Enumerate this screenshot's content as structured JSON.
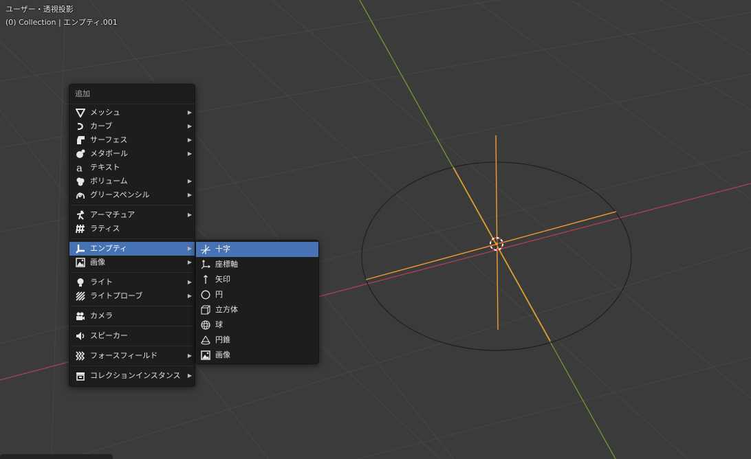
{
  "viewport": {
    "view_name": "ユーザー・透視投影",
    "object_info": "(0) Collection | エンプティ.001"
  },
  "add_menu": {
    "title": "追加",
    "items": [
      {
        "label": "メッシュ",
        "icon": "mesh-icon",
        "submenu": true
      },
      {
        "label": "カーブ",
        "icon": "curve-icon",
        "submenu": true
      },
      {
        "label": "サーフェス",
        "icon": "surface-icon",
        "submenu": true
      },
      {
        "label": "メタボール",
        "icon": "metaball-icon",
        "submenu": true
      },
      {
        "label": "テキスト",
        "icon": "text-icon",
        "submenu": false
      },
      {
        "label": "ボリューム",
        "icon": "volume-icon",
        "submenu": true
      },
      {
        "label": "グリースペンシル",
        "icon": "grease-pencil-icon",
        "submenu": true
      },
      {
        "label": "アーマチュア",
        "icon": "armature-icon",
        "submenu": true
      },
      {
        "label": "ラティス",
        "icon": "lattice-icon",
        "submenu": false
      },
      {
        "label": "エンプティ",
        "icon": "empty-icon",
        "submenu": true,
        "active": true
      },
      {
        "label": "画像",
        "icon": "image-icon",
        "submenu": true
      },
      {
        "label": "ライト",
        "icon": "light-icon",
        "submenu": true
      },
      {
        "label": "ライトプローブ",
        "icon": "light-probe-icon",
        "submenu": true
      },
      {
        "label": "カメラ",
        "icon": "camera-icon",
        "submenu": false
      },
      {
        "label": "スピーカー",
        "icon": "speaker-icon",
        "submenu": false
      },
      {
        "label": "フォースフィールド",
        "icon": "force-field-icon",
        "submenu": true
      },
      {
        "label": "コレクションインスタンス",
        "icon": "collection-instance-icon",
        "submenu": true
      }
    ]
  },
  "empty_menu": {
    "items": [
      {
        "label": "十字",
        "icon": "plain-axes-icon",
        "active": true
      },
      {
        "label": "座標軸",
        "icon": "arrows-axes-icon"
      },
      {
        "label": "矢印",
        "icon": "single-arrow-icon"
      },
      {
        "label": "円",
        "icon": "circle-icon"
      },
      {
        "label": "立方体",
        "icon": "cube-icon"
      },
      {
        "label": "球",
        "icon": "sphere-icon"
      },
      {
        "label": "円錐",
        "icon": "cone-icon"
      },
      {
        "label": "画像",
        "icon": "image-empty-icon"
      }
    ]
  },
  "colors": {
    "background": "#3b3b3b",
    "grid": "#4a4a4a",
    "x_axis": "#a9434f",
    "y_axis": "#6f9a2f",
    "selection_orange": "#f59a35",
    "menu_bg": "#1d1d1d",
    "highlight": "#4772b3"
  }
}
